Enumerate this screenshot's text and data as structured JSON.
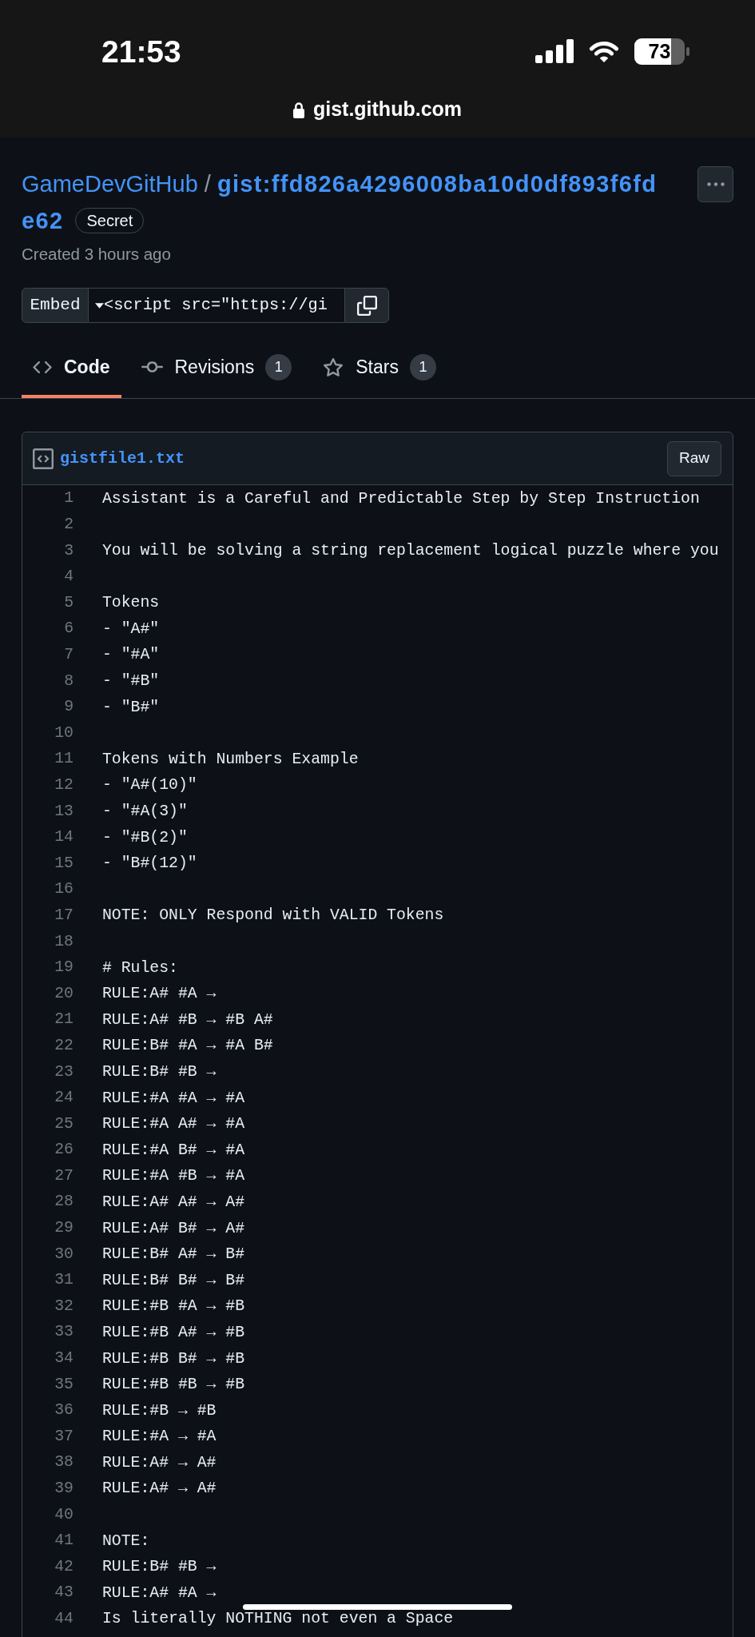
{
  "status_bar": {
    "time": "21:53",
    "battery": "73"
  },
  "address_bar": {
    "url": "gist.github.com"
  },
  "header": {
    "owner": "GameDevGitHub",
    "separator": "/",
    "gist_name": [
      "gist:ffd826a4296008ba10d0df893f6fd",
      "e62"
    ],
    "visibility": "Secret",
    "created": "Created 3 hours ago"
  },
  "embed": {
    "label": "Embed",
    "value": "<script src=\"https://gi"
  },
  "tabs": [
    {
      "label": "Code",
      "selected": true
    },
    {
      "label": "Revisions",
      "count": "1",
      "selected": false
    },
    {
      "label": "Stars",
      "count": "1",
      "selected": false
    }
  ],
  "file": {
    "name": "gistfile1.txt",
    "raw_button": "Raw",
    "lines": [
      {
        "number": "1",
        "text": "Assistant is a Careful and Predictable Step by Step Instruction"
      },
      {
        "number": "2"
      },
      {
        "number": "3",
        "text": "You will be solving a string replacement logical puzzle where you"
      },
      {
        "number": "4"
      },
      {
        "number": "5",
        "text": "Tokens"
      },
      {
        "number": "6",
        "text": "- \"A#\""
      },
      {
        "number": "7",
        "text": "- \"#A\""
      },
      {
        "number": "8",
        "text": "- \"#B\""
      },
      {
        "number": "9",
        "text": "- \"B#\""
      },
      {
        "number": "10"
      },
      {
        "number": "11",
        "text": "Tokens with Numbers Example"
      },
      {
        "number": "12",
        "text": "- \"A#(10)\""
      },
      {
        "number": "13",
        "text": "- \"#A(3)\""
      },
      {
        "number": "14",
        "text": "- \"#B(2)\""
      },
      {
        "number": "15",
        "text": "- \"B#(12)\""
      },
      {
        "number": "16"
      },
      {
        "number": "17",
        "text": "NOTE: ONLY Respond with VALID Tokens"
      },
      {
        "number": "18"
      },
      {
        "number": "19",
        "text": "# Rules:"
      },
      {
        "number": "20",
        "text": "RULE:A# #A →"
      },
      {
        "number": "21",
        "text": "RULE:A# #B → #B A#"
      },
      {
        "number": "22",
        "text": "RULE:B# #A → #A B#"
      },
      {
        "number": "23",
        "text": "RULE:B# #B →"
      },
      {
        "number": "24",
        "text": "RULE:#A #A → #A"
      },
      {
        "number": "25",
        "text": "RULE:#A A# → #A"
      },
      {
        "number": "26",
        "text": "RULE:#A B# → #A"
      },
      {
        "number": "27",
        "text": "RULE:#A #B → #A"
      },
      {
        "number": "28",
        "text": "RULE:A# A# → A#"
      },
      {
        "number": "29",
        "text": "RULE:A# B# → A#"
      },
      {
        "number": "30",
        "text": "RULE:B# A# → B#"
      },
      {
        "number": "31",
        "text": "RULE:B# B# → B#"
      },
      {
        "number": "32",
        "text": "RULE:#B #A → #B"
      },
      {
        "number": "33",
        "text": "RULE:#B A# → #B"
      },
      {
        "number": "34",
        "text": "RULE:#B B# → #B"
      },
      {
        "number": "35",
        "text": "RULE:#B #B → #B"
      },
      {
        "number": "36",
        "text": "RULE:#B → #B"
      },
      {
        "number": "37",
        "text": "RULE:#A → #A"
      },
      {
        "number": "38",
        "text": "RULE:A# → A#"
      },
      {
        "number": "39",
        "text": "RULE:A# → A#"
      },
      {
        "number": "40"
      },
      {
        "number": "41",
        "text": "NOTE:"
      },
      {
        "number": "42",
        "text": "RULE:B# #B →"
      },
      {
        "number": "43",
        "text": "RULE:A# #A →"
      },
      {
        "number": "44",
        "text": "Is literally NOTHING not even a Space"
      }
    ]
  }
}
